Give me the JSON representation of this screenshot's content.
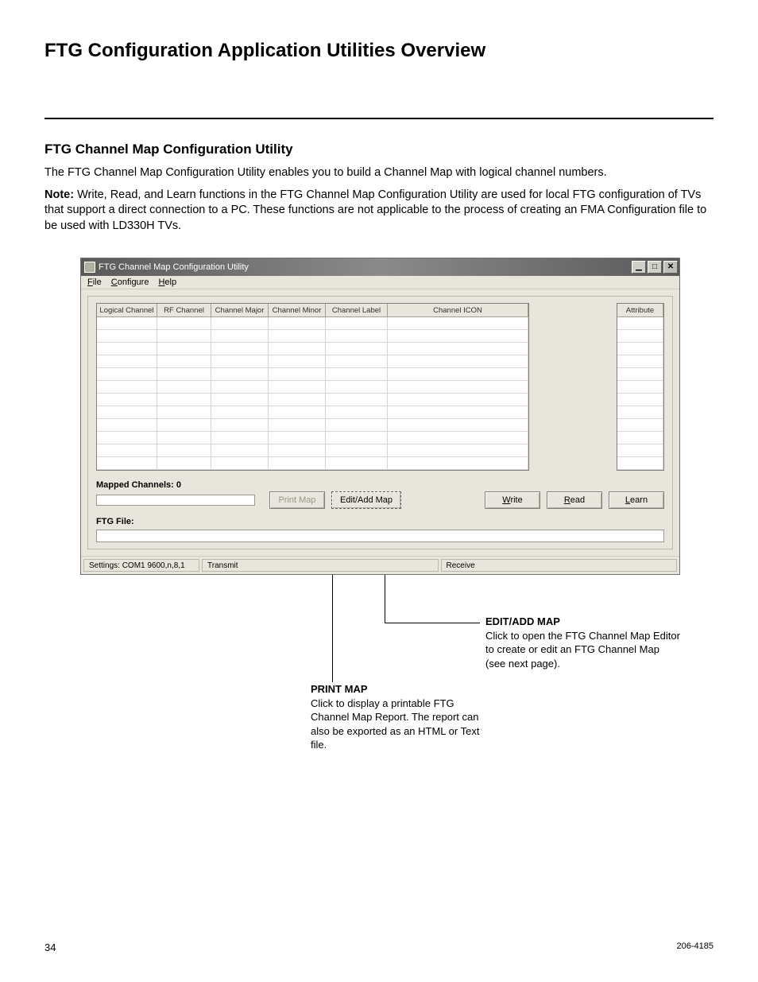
{
  "page": {
    "title": "FTG Configuration Application Utilities Overview",
    "section_heading": "FTG Channel Map Configuration Utility",
    "intro": "The FTG Channel Map Configuration Utility enables you to build a Channel Map with logical channel numbers.",
    "note_label": "Note:",
    "note_body": " Write, Read, and Learn functions in the FTG Channel Map Configuration Utility are used for local FTG configuration of TVs that support a direct connection to a PC. These functions are not applicable to the process of creating an FMA Configuration file to be used with LD330H TVs.",
    "number": "34",
    "docnum": "206-4185"
  },
  "window": {
    "title": "FTG Channel Map Configuration Utility",
    "menu": {
      "file": "File",
      "configure": "Configure",
      "help": "Help",
      "file_u": "F",
      "configure_u": "C",
      "help_u": "H"
    },
    "columns": {
      "c1": "Logical Channel",
      "c2": "RF Channel",
      "c3": "Channel Major",
      "c4": "Channel Minor",
      "c5": "Channel Label",
      "c6": "Channel ICON",
      "attr": "Attribute"
    },
    "mapped_label": "Mapped Channels: 0",
    "buttons": {
      "print": "Print Map",
      "editadd": "Edit/Add Map",
      "write": "Write",
      "read": "Read",
      "learn": "Learn",
      "write_u": "W",
      "read_u": "R",
      "learn_u": "L"
    },
    "ftg_file_label": "FTG File:",
    "status": {
      "settings": "Settings: COM1 9600,n,8,1",
      "transmit": "Transmit",
      "receive": "Receive"
    }
  },
  "callouts": {
    "edit": {
      "heading": "EDIT/ADD MAP",
      "body": "Click to open the FTG Channel Map Editor to create or edit an FTG Channel Map (see next page)."
    },
    "print": {
      "heading": "PRINT MAP",
      "body": "Click to display a printable FTG Channel Map Report. The report can also be exported as an HTML or Text file."
    }
  }
}
